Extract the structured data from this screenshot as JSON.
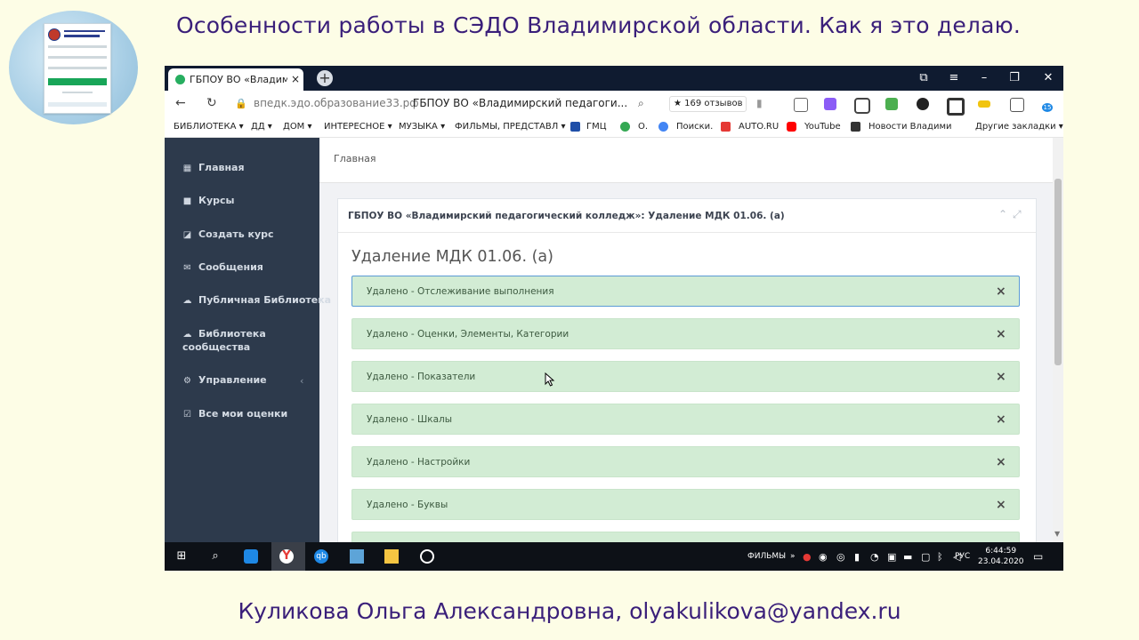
{
  "slide": {
    "title": "Особенности работы в СЭДО Владимирской области. Как я это делаю.",
    "footer": "Куликова Ольга Александровна, olyakulikova@yandex.ru"
  },
  "browser": {
    "tab_title": "ГБПОУ ВО «Владимирс",
    "tab_close": "×",
    "url": "впедк.эдо.образование33.рф",
    "page_title": "ГБПОУ ВО «Владимирский педагоги...",
    "reviews": "★ 169 отзывов",
    "bookmarks": [
      "БИБЛИОТЕКА ▾",
      "ДД ▾",
      "ДОМ ▾",
      "ИНТЕРЕСНОЕ ▾",
      "МУЗЫКА ▾",
      "ФИЛЬМЫ, ПРЕДСТАВЛ ▾",
      "ГМЦ",
      "О.",
      "Поиски.",
      "AUTO.RU",
      "YouTube",
      "Новости Владими"
    ],
    "other_bookmarks": "Другие закладки ▾",
    "ext_badge": "15"
  },
  "sidebar": {
    "items": [
      {
        "icon": "▦",
        "label": "Главная"
      },
      {
        "icon": "■",
        "label": "Курсы"
      },
      {
        "icon": "◪",
        "label": "Создать курс"
      },
      {
        "icon": "✉",
        "label": "Сообщения"
      },
      {
        "icon": "☁",
        "label": "Публичная Библиотека"
      },
      {
        "icon": "☁",
        "label": "Библиотека"
      },
      {
        "icon": "⚙",
        "label": "Управление"
      },
      {
        "icon": "☑",
        "label": "Все мои оценки"
      }
    ],
    "library_sub": "сообщества",
    "collapse_arrow": "‹"
  },
  "main": {
    "breadcrumb": "Главная",
    "panel_title": "ГБПОУ ВО «Владимирский педагогический колледж»: Удаление МДК 01.06. (а)",
    "heading": "Удаление МДК 01.06. (а)",
    "alerts": [
      "Удалено - Отслеживание выполнения",
      "Удалено - Оценки, Элементы, Категории",
      "Удалено - Показатели",
      "Удалено - Шкалы",
      "Удалено - Настройки",
      "Удалено - Буквы"
    ],
    "close_glyph": "×"
  },
  "taskbar": {
    "tray_label": "ФИЛЬМЫ",
    "lang": "РУС",
    "time": "6:44:59",
    "date": "23.04.2020"
  }
}
